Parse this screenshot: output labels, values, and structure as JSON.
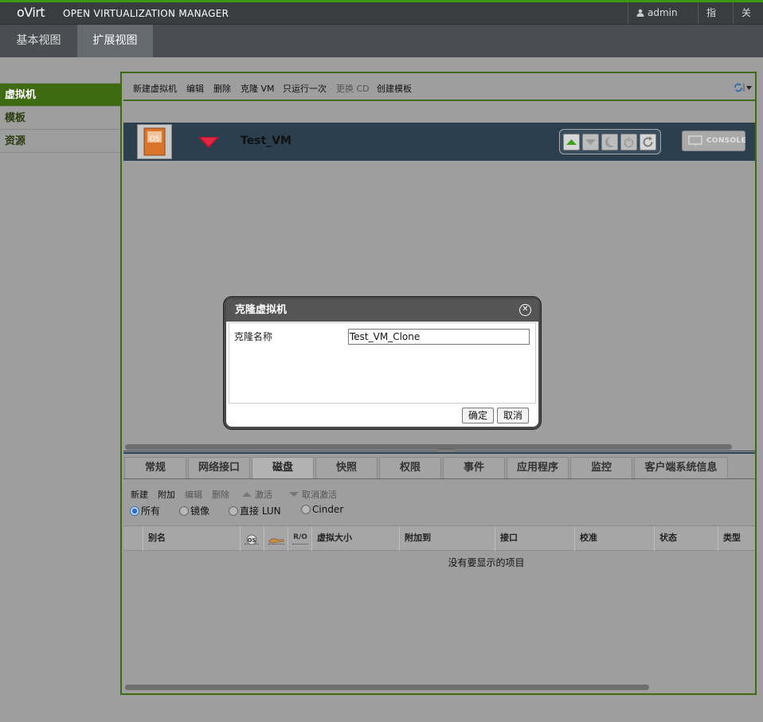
{
  "header": {
    "logo": "oVirt",
    "product": "OPEN VIRTUALIZATION MANAGER",
    "user": "admin",
    "guide": "指南",
    "about": "关于"
  },
  "views": [
    "基本视图",
    "扩展视图"
  ],
  "nav": [
    "虚拟机",
    "模板",
    "资源"
  ],
  "actions": {
    "new_vm": "新建虚拟机",
    "edit": "编辑",
    "delete": "删除",
    "clone": "克隆 VM",
    "run_once": "只运行一次",
    "change_cd": "更换 CD",
    "make_template": "创建模板"
  },
  "vm": {
    "name": "Test_VM",
    "os_icon_text": "OS",
    "console": "CONSOLE"
  },
  "subtabs": [
    "常规",
    "网络接口",
    "磁盘",
    "快照",
    "权限",
    "事件",
    "应用程序",
    "监控",
    "客户端系统信息"
  ],
  "disk_actions": {
    "new": "新建",
    "attach": "附加",
    "edit": "编辑",
    "delete": "删除",
    "activate": "激活",
    "deactivate": "取消激活"
  },
  "disk_filter": {
    "all": "所有",
    "image": "镜像",
    "lun": "直接 LUN",
    "cinder": "Cinder",
    "selected": "所有"
  },
  "table": {
    "columns": [
      "别名",
      "虚拟大小",
      "附加到",
      "接口",
      "校准",
      "状态",
      "类型"
    ],
    "icon_columns": [
      "OS",
      "R/O"
    ],
    "empty": "没有要显示的项目"
  },
  "dialog": {
    "title": "克隆虚拟机",
    "clone_name_label": "克隆名称",
    "clone_name_value": "Test_VM_Clone",
    "ok": "确定",
    "cancel": "取消"
  },
  "colors": {
    "accent_green": "#3e6a12",
    "top_border": "#3a9a10",
    "vm_row": "#2b3f4e",
    "status_down_red": "#c8102e",
    "run_green": "#4caf1e"
  }
}
